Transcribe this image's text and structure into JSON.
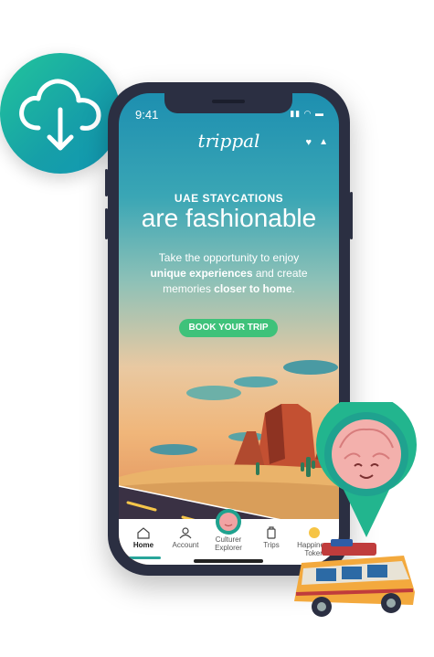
{
  "status_bar": {
    "time": "9:41",
    "icons": "▮▮ ◠ ▬"
  },
  "app": {
    "brand": "trippal"
  },
  "hero": {
    "headline_small": "UAE STAYCATIONS",
    "headline_large": "are fashionable",
    "body_line1": "Take the opportunity to enjoy",
    "body_bold1": "unique experiences",
    "body_mid": " and create",
    "body_line3": "memories ",
    "body_bold2": "closer to home",
    "body_end": ".",
    "cta_label": "BOOK YOUR TRIP"
  },
  "tabs": [
    {
      "label": "Home",
      "icon": "home-icon",
      "active": true
    },
    {
      "label": "Account",
      "icon": "user-icon"
    },
    {
      "label": "Culturer Explorer",
      "icon": "mascot-icon"
    },
    {
      "label": "Trips",
      "icon": "luggage-icon"
    },
    {
      "label": "Happiness Token",
      "icon": "token-icon"
    }
  ],
  "colors": {
    "accent": "#3ec27a",
    "phone": "#2b2f42",
    "teal": "#169fa8"
  }
}
